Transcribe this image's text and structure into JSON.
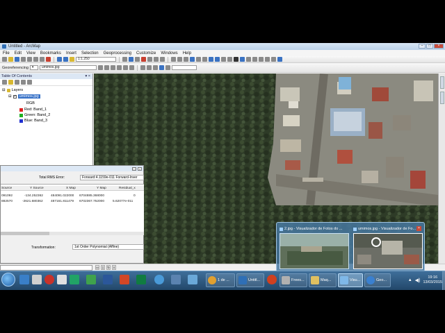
{
  "window": {
    "title": "Untitled - ArcMap"
  },
  "menu": [
    "File",
    "Edit",
    "View",
    "Bookmarks",
    "Insert",
    "Selection",
    "Geoprocessing",
    "Customize",
    "Windows",
    "Help"
  ],
  "toolbar": {
    "scale": "1:1.250"
  },
  "georef_toolbar": {
    "label": "Georeferencing",
    "layer": "umimos.jpg"
  },
  "toc": {
    "title": "Table Of Contents",
    "layers_label": "Layers",
    "layer_name": "umimos.jpg",
    "rgb_label": "RGB",
    "bands": [
      {
        "label": "Red:   Band_1",
        "color": "#e02020"
      },
      {
        "label": "Green: Band_2",
        "color": "#20b020"
      },
      {
        "label": "Blue:  Band_3",
        "color": "#2030d0"
      }
    ]
  },
  "link_table": {
    "rms_label": "Total RMS Error:",
    "rms_value": "Forward:4.1159e-011  Forward-Inver",
    "columns": [
      "Source",
      "Y Source",
      "X Map",
      "Y Map",
      "Residual_x"
    ],
    "rows": [
      [
        "091092",
        "-134.252362",
        "484091.022000",
        "6704885.368000",
        "0"
      ],
      [
        "882570",
        "-2621.680362",
        "487161.811479",
        "6702367.752000",
        "5.62077e-011"
      ]
    ],
    "transformation_label": "Transformation:",
    "transformation_value": "1st Order Polynomial (Affine)"
  },
  "thumbnails": [
    {
      "caption": "2.jpg - Visualizador de Fotos do ..."
    },
    {
      "caption": "umimos.jpg - Visualizador de Fo..."
    }
  ],
  "taskbar": {
    "tasks": [
      "1 de ...",
      "Untitl...",
      "Frees...",
      "Maq...",
      "Visu...",
      "Geo..."
    ],
    "time": "19:16",
    "date": "13/03/2015"
  },
  "colors": {
    "accent": "#3570c7",
    "taskbar": "#2b5680",
    "forest": "#2f3d28"
  }
}
